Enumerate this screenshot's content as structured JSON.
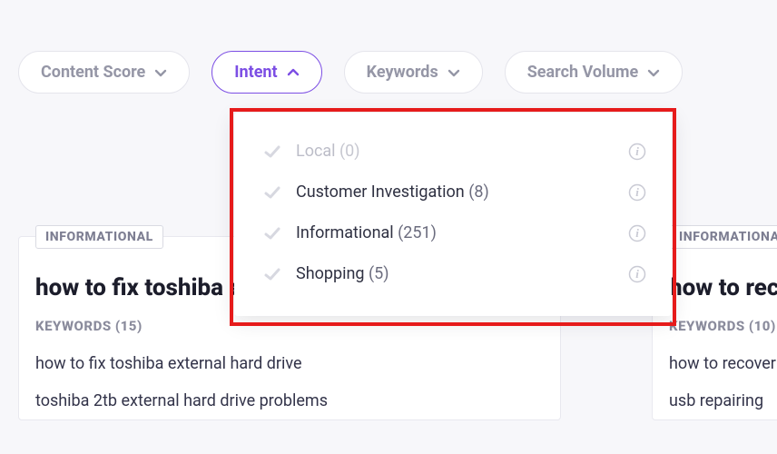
{
  "filters": {
    "content_score": "Content Score",
    "intent": "Intent",
    "keywords": "Keywords",
    "search_volume": "Search Volume"
  },
  "intent_menu": {
    "items": [
      {
        "label": "Local",
        "count": 0,
        "disabled": true
      },
      {
        "label": "Customer Investigation",
        "count": 8,
        "disabled": false
      },
      {
        "label": "Informational",
        "count": 251,
        "disabled": false
      },
      {
        "label": "Shopping",
        "count": 5,
        "disabled": false
      }
    ]
  },
  "cards": [
    {
      "badge": "INFORMATIONAL",
      "title": "how to fix toshiba external hard drive",
      "keyword_count": 15,
      "keywords_label": "KEYWORDS",
      "keywords": [
        "how to fix toshiba external hard drive",
        "toshiba 2tb external hard drive problems"
      ]
    },
    {
      "badge": "INFORMATIONAL",
      "title": "how to recover corrupted files from usb",
      "keyword_count": 10,
      "keywords_label": "KEYWORDS",
      "keywords": [
        "how to recover corrupted files from usb",
        "usb repairing"
      ]
    }
  ]
}
